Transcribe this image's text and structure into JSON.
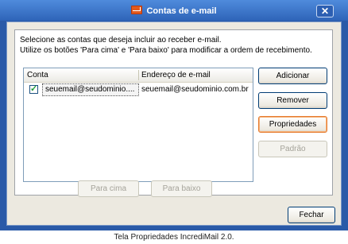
{
  "window": {
    "title": "Contas de e-mail",
    "close_label": "✕"
  },
  "instructions": {
    "line1": "Selecione as contas que deseja incluir ao receber e-mail.",
    "line2": "Utilize os botões 'Para cima' e 'Para baixo' para modificar a ordem de recebimento."
  },
  "accounts_list": {
    "columns": [
      "Conta",
      "Endereço de e-mail"
    ],
    "rows": [
      {
        "checked": true,
        "account": "seuemail@seudominio....",
        "email": "seuemail@seudominio.com.br"
      }
    ]
  },
  "buttons": {
    "add": "Adicionar",
    "remove": "Remover",
    "properties": "Propriedades",
    "default": "Padrão",
    "move_up": "Para cima",
    "move_down": "Para baixo",
    "close": "Fechar"
  },
  "caption": "Tela Propriedades IncrediMail 2.0."
}
